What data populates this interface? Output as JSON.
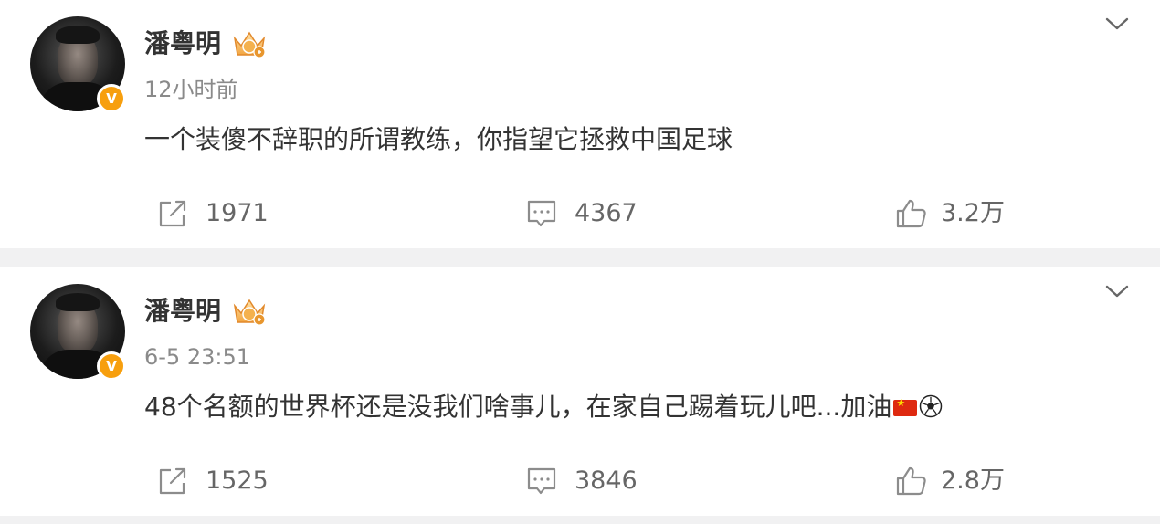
{
  "posts": [
    {
      "username": "潘粤明",
      "timestamp": "12小时前",
      "content": "一个装傻不辞职的所谓教练，你指望它拯救中国足球",
      "emoji": [],
      "reposts": "1971",
      "comments": "4367",
      "likes": "3.2万"
    },
    {
      "username": "潘粤明",
      "timestamp": "6-5 23:51",
      "content": "48个名额的世界杯还是没我们啥事儿，在家自己踢着玩儿吧...加油",
      "emoji": [
        "china-flag-emoji",
        "soccer-ball-emoji"
      ],
      "reposts": "1525",
      "comments": "3846",
      "likes": "2.8万"
    }
  ],
  "verified_badge_letter": "V",
  "colors": {
    "page_background": "#f1f1f2",
    "card_background": "#ffffff",
    "text_primary": "#333333",
    "text_secondary": "#8a8a8a",
    "verified_badge": "#f79f0e",
    "icon_gray": "#8c8c8c"
  },
  "icons": {
    "repost": "repost-icon",
    "comment": "comment-icon",
    "like": "thumbs-up-icon",
    "menu": "chevron-down-icon",
    "member_badge": "crown-badge-icon"
  }
}
